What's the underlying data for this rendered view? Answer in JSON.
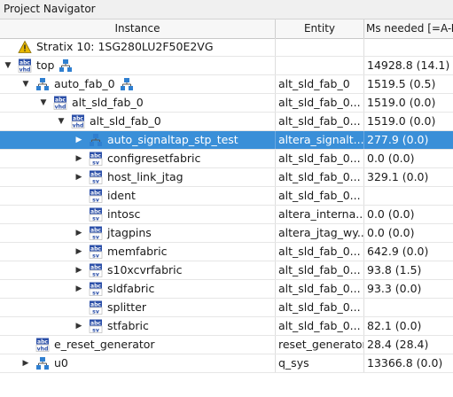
{
  "window": {
    "title": "Project Navigator"
  },
  "columns": {
    "instance": "Instance",
    "entity": "Entity",
    "alms": "Ms needed [=A-B"
  },
  "rows": [
    {
      "name": "Stratix 10: 1SG280LU2F50E2VG",
      "entity": "",
      "alms": "",
      "icon": "device-warning-icon",
      "twisty": "",
      "level": 0,
      "selected": false,
      "hier": false
    },
    {
      "name": "top",
      "entity": "",
      "alms": "14928.8 (14.1)",
      "icon": "vhd-file-icon",
      "twisty": "expanded",
      "level": 0,
      "selected": false,
      "hier": true
    },
    {
      "name": "auto_fab_0",
      "entity": "alt_sld_fab_0",
      "alms": "1519.5 (0.5)",
      "icon": "hierarchy-icon",
      "twisty": "expanded",
      "level": 1,
      "selected": false,
      "hier": true
    },
    {
      "name": "alt_sld_fab_0",
      "entity": "alt_sld_fab_0...",
      "alms": "1519.0 (0.0)",
      "icon": "vhd-file-icon",
      "twisty": "expanded",
      "level": 2,
      "selected": false,
      "hier": false
    },
    {
      "name": "alt_sld_fab_0",
      "entity": "alt_sld_fab_0...",
      "alms": "1519.0 (0.0)",
      "icon": "vhd-file-icon",
      "twisty": "expanded",
      "level": 3,
      "selected": false,
      "hier": false
    },
    {
      "name": "auto_signaltap_stp_test",
      "entity": "altera_signalt...",
      "alms": "277.9 (0.0)",
      "icon": "hierarchy-icon",
      "twisty": "collapsed",
      "level": 4,
      "selected": true,
      "hier": false
    },
    {
      "name": "configresetfabric",
      "entity": "alt_sld_fab_0...",
      "alms": "0.0 (0.0)",
      "icon": "sv-file-icon",
      "twisty": "collapsed",
      "level": 4,
      "selected": false,
      "hier": false
    },
    {
      "name": "host_link_jtag",
      "entity": "alt_sld_fab_0...",
      "alms": "329.1 (0.0)",
      "icon": "sv-file-icon",
      "twisty": "collapsed",
      "level": 4,
      "selected": false,
      "hier": false
    },
    {
      "name": "ident",
      "entity": "alt_sld_fab_0...",
      "alms": "",
      "icon": "sv-file-icon",
      "twisty": "",
      "level": 4,
      "selected": false,
      "hier": false
    },
    {
      "name": "intosc",
      "entity": "altera_interna...",
      "alms": "0.0 (0.0)",
      "icon": "sv-file-icon",
      "twisty": "",
      "level": 4,
      "selected": false,
      "hier": false
    },
    {
      "name": "jtagpins",
      "entity": "altera_jtag_wy...",
      "alms": "0.0 (0.0)",
      "icon": "sv-file-icon",
      "twisty": "collapsed",
      "level": 4,
      "selected": false,
      "hier": false
    },
    {
      "name": "memfabric",
      "entity": "alt_sld_fab_0...",
      "alms": "642.9 (0.0)",
      "icon": "sv-file-icon",
      "twisty": "collapsed",
      "level": 4,
      "selected": false,
      "hier": false
    },
    {
      "name": "s10xcvrfabric",
      "entity": "alt_sld_fab_0...",
      "alms": "93.8 (1.5)",
      "icon": "sv-file-icon",
      "twisty": "collapsed",
      "level": 4,
      "selected": false,
      "hier": false
    },
    {
      "name": "sldfabric",
      "entity": "alt_sld_fab_0...",
      "alms": "93.3 (0.0)",
      "icon": "sv-file-icon",
      "twisty": "collapsed",
      "level": 4,
      "selected": false,
      "hier": false
    },
    {
      "name": "splitter",
      "entity": "alt_sld_fab_0...",
      "alms": "",
      "icon": "sv-file-icon",
      "twisty": "",
      "level": 4,
      "selected": false,
      "hier": false
    },
    {
      "name": "stfabric",
      "entity": "alt_sld_fab_0...",
      "alms": "82.1 (0.0)",
      "icon": "sv-file-icon",
      "twisty": "collapsed",
      "level": 4,
      "selected": false,
      "hier": false
    },
    {
      "name": "e_reset_generator",
      "entity": "reset_generator",
      "alms": "28.4 (28.4)",
      "icon": "vhd-file-icon",
      "twisty": "",
      "level": 1,
      "selected": false,
      "hier": false
    },
    {
      "name": "u0",
      "entity": "q_sys",
      "alms": "13366.8 (0.0)",
      "icon": "hierarchy-icon",
      "twisty": "collapsed",
      "level": 1,
      "selected": false,
      "hier": false
    }
  ],
  "colors": {
    "selection": "#3a8fd8",
    "vhd_icon": "#2b4fa8",
    "sv_icon": "#2b4fa8",
    "hierarchy_icon": "#2f7fd0",
    "warning": "#e8b800"
  }
}
